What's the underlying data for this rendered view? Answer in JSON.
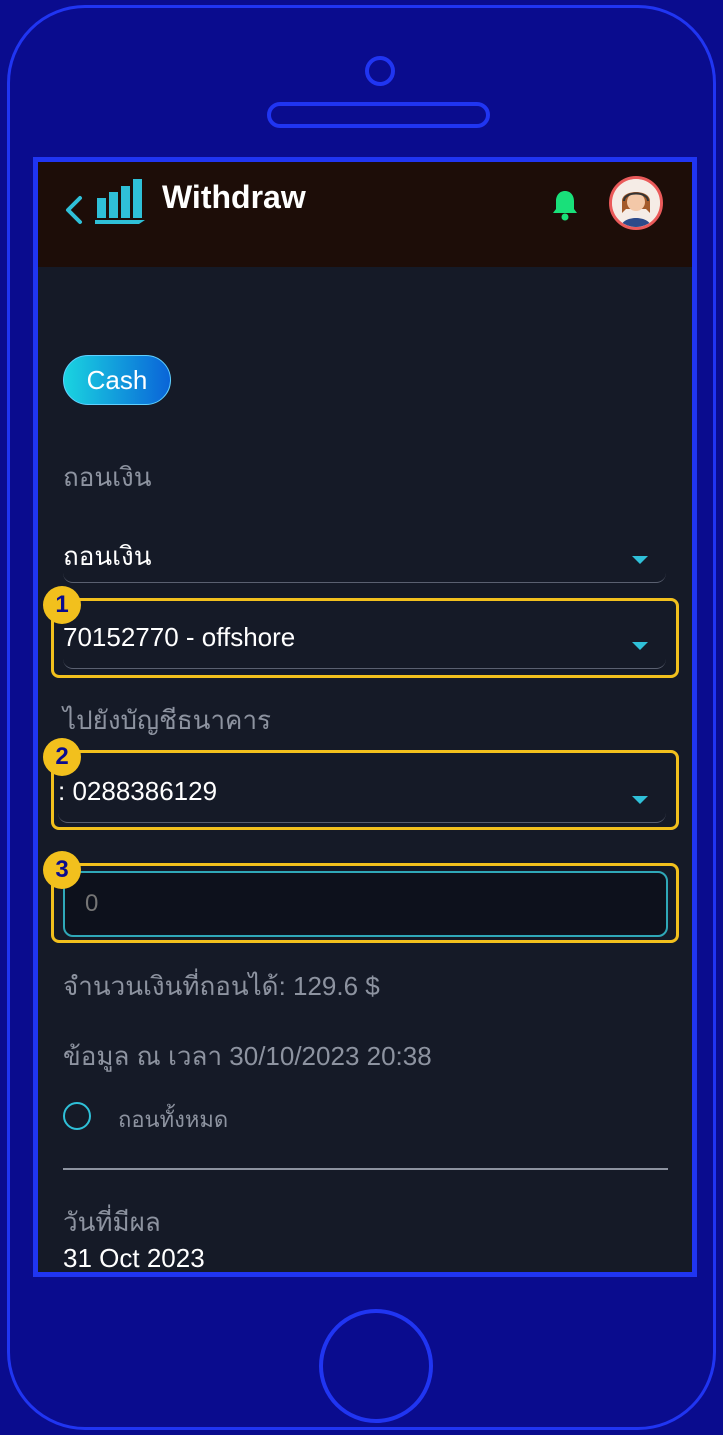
{
  "header": {
    "title": "Withdraw",
    "back_icon": "chevron-left-icon",
    "logo_icon": "bar-chart-logo-icon",
    "bell_icon": "bell-icon",
    "avatar_icon": "support-agent-avatar"
  },
  "tab": {
    "label": "Cash"
  },
  "form": {
    "type_label": "ถอนเงิน",
    "type_value": "ถอนเงิน",
    "account_value": "70152770 - offshore",
    "bank_label": "ไปยังบัญชีธนาคาร",
    "bank_value": ": 0288386129",
    "amount_placeholder": "0",
    "available_text": "จำนวนเงินที่ถอนได้: 129.6 $",
    "timestamp_text": "ข้อมูล ณ เวลา 30/10/2023 20:38",
    "withdraw_all_label": "ถอนทั้งหมด",
    "effective_date_label": "วันที่มีผล",
    "effective_date_value": "31 Oct 2023"
  },
  "callouts": [
    "1",
    "2",
    "3"
  ],
  "colors": {
    "frame": "#2035f2",
    "background": "#0a0c8e",
    "highlight": "#f2c01d",
    "accent": "#2fc0d8",
    "bell": "#19e07a"
  }
}
